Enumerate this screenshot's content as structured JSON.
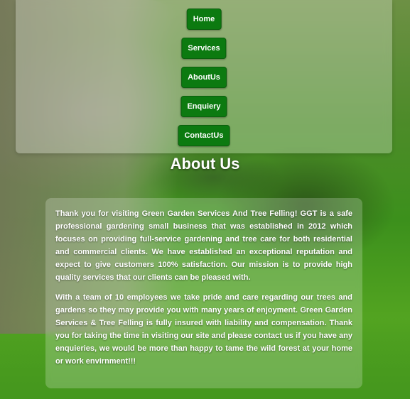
{
  "nav": {
    "items": [
      {
        "label": "Home"
      },
      {
        "label": "Services"
      },
      {
        "label": "AboutUs"
      },
      {
        "label": "Enquiery"
      },
      {
        "label": "ContactUs"
      }
    ]
  },
  "page": {
    "title": "About Us"
  },
  "content": {
    "paragraphs": [
      "Thank you for visiting Green Garden Services And Tree Felling! GGT is a safe professional gardening small business that was established in 2012 which focuses on providing full-service gardening and tree care for both residential and commercial clients. We have established an exceptional reputation and expect to give customers 100% satisfaction. Our mission is to provide high quality services that our clients can be pleased with.",
      "With a team of 10 employees we take pride and care regarding our trees and gardens so they may provide you with many years of enjoyment. Green Garden Services & Tree Felling is fully insured with liability and compensation. Thank you for taking the time in visiting our site and please contact us if you have any enquieries, we would be more than happy to tame the wild forest at your home or work envirnment!!!"
    ]
  },
  "colors": {
    "button_bg": "#0c7a10",
    "button_text": "#ffffff",
    "text": "#ffffff"
  }
}
